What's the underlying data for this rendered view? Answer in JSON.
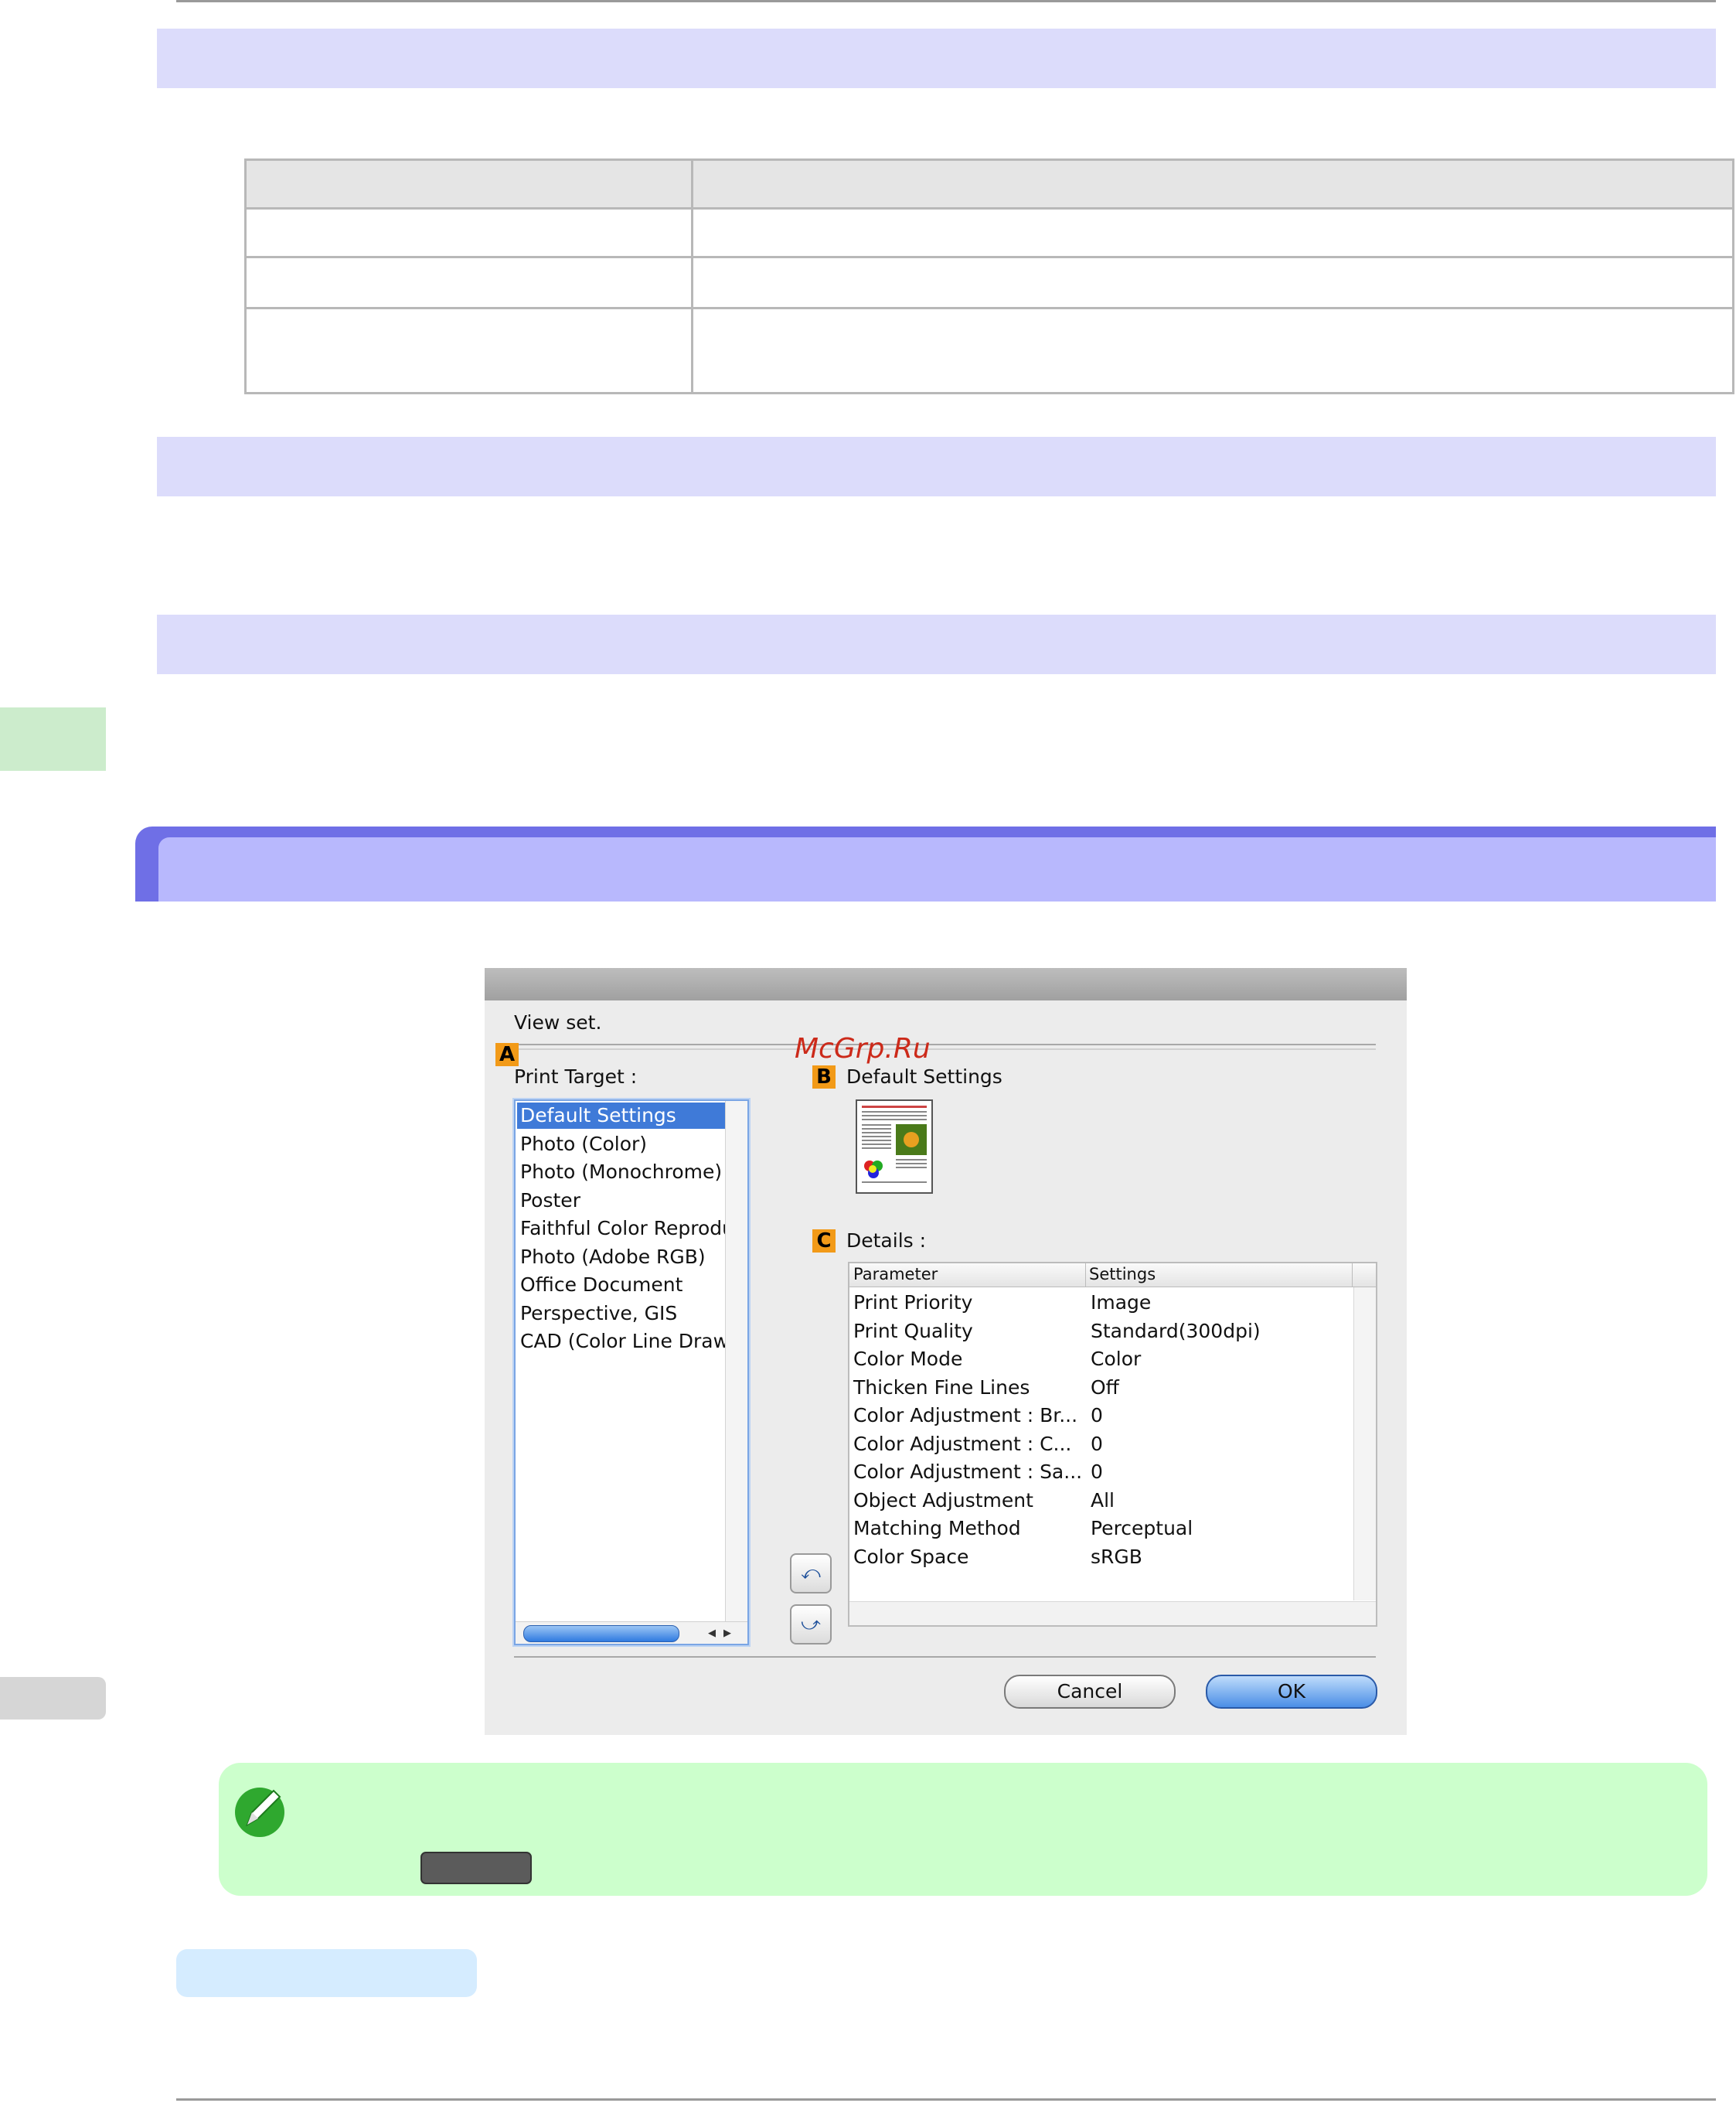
{
  "watermark": "McGrp.Ru",
  "dialog": {
    "view_set_label": "View set.",
    "marker_a": "A",
    "marker_b": "B",
    "marker_c": "C",
    "print_target_label": "Print Target :",
    "default_settings_label": "Default Settings",
    "details_label": "Details :",
    "print_targets": [
      "Default Settings",
      "Photo (Color)",
      "Photo (Monochrome)",
      "Poster",
      "Faithful Color Reproduct",
      "Photo (Adobe RGB)",
      "Office Document",
      "Perspective, GIS",
      "CAD (Color Line Drawing"
    ],
    "selected_index": 0,
    "details_headers": {
      "parameter": "Parameter",
      "settings": "Settings"
    },
    "details_rows": [
      {
        "param": "Print Priority",
        "value": "Image"
      },
      {
        "param": "Print Quality",
        "value": "Standard(300dpi)"
      },
      {
        "param": "Color Mode",
        "value": "Color"
      },
      {
        "param": "Thicken Fine Lines",
        "value": "Off"
      },
      {
        "param": "Color Adjustment : Br...",
        "value": "0"
      },
      {
        "param": "Color Adjustment : C...",
        "value": "0"
      },
      {
        "param": "Color Adjustment : Sa...",
        "value": "0"
      },
      {
        "param": "Object Adjustment",
        "value": "All"
      },
      {
        "param": "Matching Method",
        "value": "Perceptual"
      },
      {
        "param": "Color Space",
        "value": "sRGB"
      }
    ],
    "cancel_label": "Cancel",
    "ok_label": "OK"
  },
  "colors": {
    "band": "#dcdcfb",
    "section_head": "#b8b8fd",
    "note_bg": "#ccffcc",
    "subhead_bg": "#d5ecff",
    "selection": "#3f7ad8",
    "marker": "#f29a18"
  },
  "icons": {
    "note": "pencil-icon",
    "import": "import-icon",
    "export": "export-icon"
  }
}
